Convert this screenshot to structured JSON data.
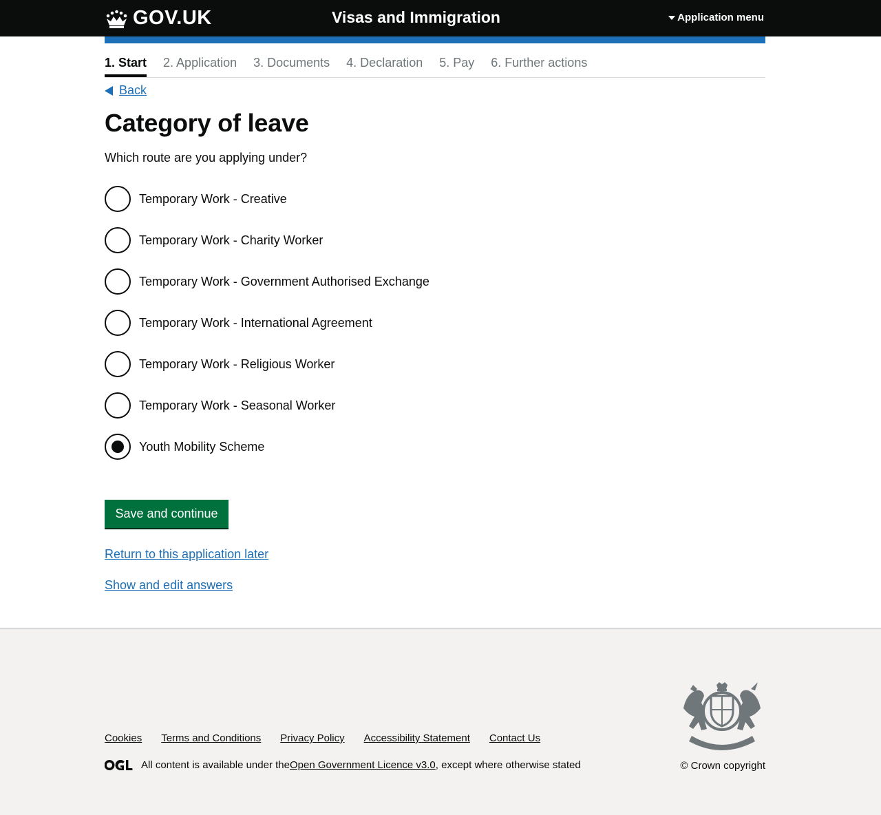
{
  "header": {
    "logo_text": "GOV.UK",
    "service_name": "Visas and Immigration",
    "menu_label": "Application menu"
  },
  "steps": [
    {
      "label": "1. Start",
      "active": true
    },
    {
      "label": "2. Application",
      "active": false
    },
    {
      "label": "3. Documents",
      "active": false
    },
    {
      "label": "4. Declaration",
      "active": false
    },
    {
      "label": "5. Pay",
      "active": false
    },
    {
      "label": "6. Further actions",
      "active": false
    }
  ],
  "back_label": "Back",
  "page": {
    "title": "Category of leave",
    "question": "Which route are you applying under?"
  },
  "options": [
    {
      "label": "Temporary Work - Creative",
      "checked": false
    },
    {
      "label": "Temporary Work - Charity Worker",
      "checked": false
    },
    {
      "label": "Temporary Work - Government Authorised Exchange",
      "checked": false
    },
    {
      "label": "Temporary Work - International Agreement",
      "checked": false
    },
    {
      "label": "Temporary Work - Religious Worker",
      "checked": false
    },
    {
      "label": "Temporary Work - Seasonal Worker",
      "checked": false
    },
    {
      "label": "Youth Mobility Scheme",
      "checked": true
    }
  ],
  "actions": {
    "save_label": "Save and continue",
    "return_later_label": "Return to this application later",
    "show_edit_label": "Show and edit answers"
  },
  "footer": {
    "links": [
      "Cookies",
      "Terms and Conditions",
      "Privacy Policy",
      "Accessibility Statement",
      "Contact Us"
    ],
    "licence_prefix": "All content is available under the ",
    "licence_link": "Open Government Licence v3.0",
    "licence_suffix": ", except where otherwise stated",
    "copyright": "© Crown copyright"
  },
  "colors": {
    "header_bg": "#0b0c0c",
    "accent_blue": "#1d70b8",
    "button_green": "#00703c",
    "footer_bg": "#f3f2f1"
  },
  "icons": [
    "crown-icon",
    "menu-triangle-icon",
    "back-arrow-icon",
    "ogl-logo-icon",
    "royal-crest-icon"
  ]
}
